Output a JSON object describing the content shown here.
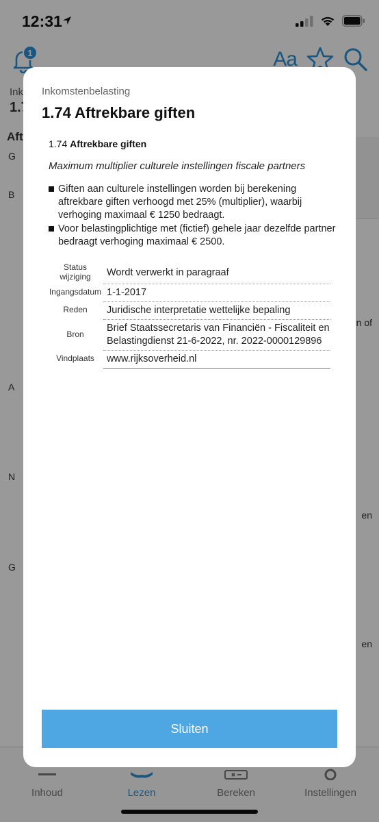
{
  "status_bar": {
    "time": "12:31"
  },
  "header": {
    "notification_count": "1",
    "font_button": "Aa"
  },
  "background": {
    "subtitle": "Ink",
    "number": "1.7",
    "heading": "Aft",
    "letters": [
      "G",
      "B",
      "A",
      "N",
      "G"
    ],
    "right_texts": [
      "n of",
      "en",
      "en"
    ]
  },
  "modal": {
    "subtitle": "Inkomstenbelasting",
    "title": "1.74  Aftrekbare giften",
    "content_number": "1.74 ",
    "content_title": "Aftrekbare giften",
    "italic_heading": "Maximum multiplier culturele instellingen fiscale partners",
    "bullets": [
      "Giften aan culturele instellingen worden bij berekening aftrekbare giften verhoogd met 25% (multiplier), waarbij verhoging maximaal € 1250 bedraagt.",
      "Voor belastingplichtige met (fictief) gehele jaar dezelfde partner bedraagt verhoging maximaal € 2500."
    ],
    "meta": [
      {
        "label": "Status wijziging",
        "value": "Wordt verwerkt in paragraaf"
      },
      {
        "label": "Ingangsdatum",
        "value": "1-1-2017"
      },
      {
        "label": "Reden",
        "value": "Juridische interpretatie wettelijke bepaling"
      },
      {
        "label": "Bron",
        "value": "Brief Staatssecretaris van Financiën - Fiscaliteit en Belastingdienst 21-6-2022, nr. 2022-0000129896"
      },
      {
        "label": "Vindplaats",
        "value": "www.rijksoverheid.nl"
      }
    ],
    "close_label": "Sluiten"
  },
  "tabs": [
    {
      "label": "Inhoud",
      "icon": "list-icon"
    },
    {
      "label": "Lezen",
      "icon": "book-icon",
      "active": true
    },
    {
      "label": "Bereken",
      "icon": "calculator-icon"
    },
    {
      "label": "Instellingen",
      "icon": "gear-icon"
    }
  ],
  "colors": {
    "accent": "#2c8fd6",
    "button": "#4ea6e2"
  }
}
